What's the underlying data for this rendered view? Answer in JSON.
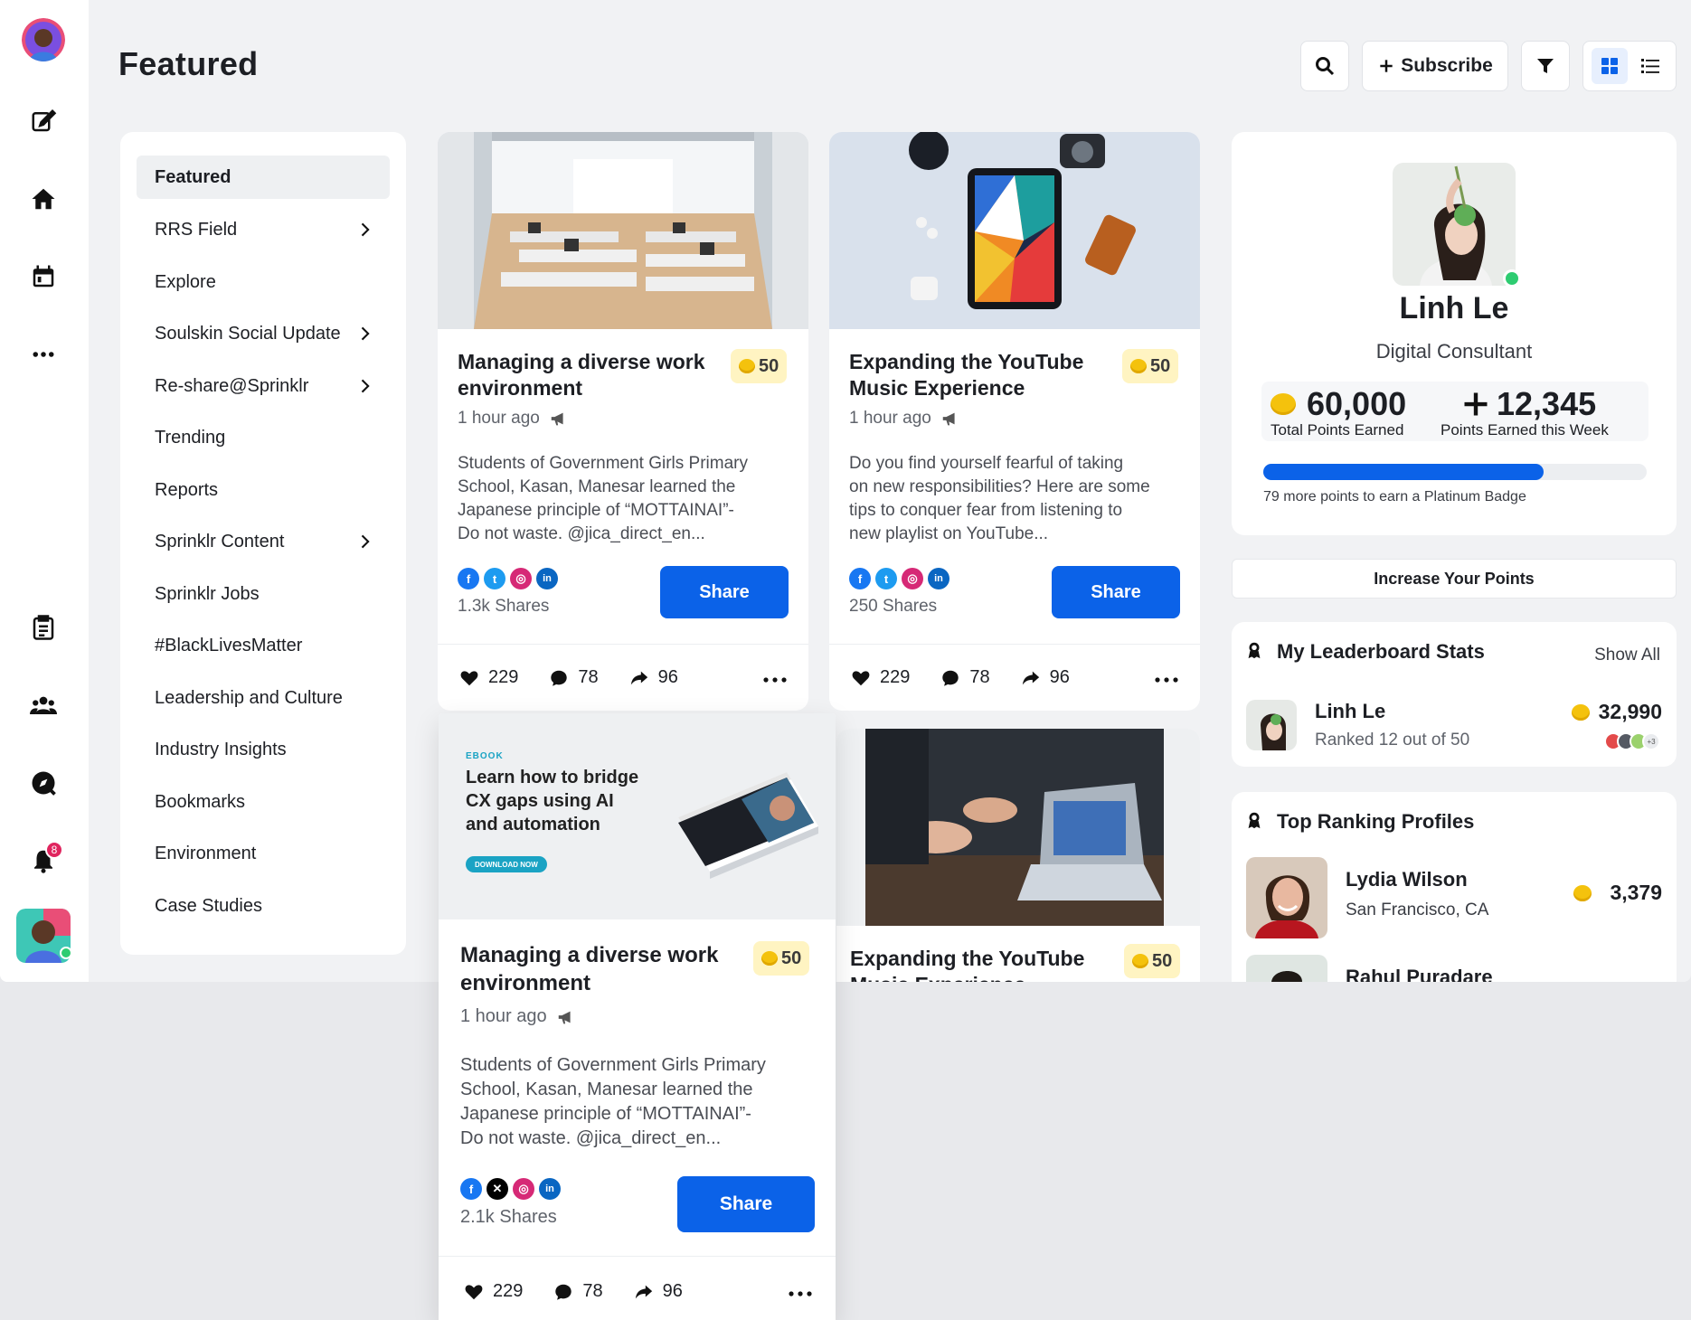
{
  "header": {
    "title": "Featured",
    "subscribe_label": "Subscribe"
  },
  "rail": {
    "notification_count": "8"
  },
  "nav": {
    "items": [
      {
        "label": "Featured"
      },
      {
        "label": "RRS Field"
      },
      {
        "label": "Explore"
      },
      {
        "label": "Soulskin Social Update"
      },
      {
        "label": "Re-share@Sprinklr"
      },
      {
        "label": "Trending"
      },
      {
        "label": "Reports"
      },
      {
        "label": "Sprinklr Content"
      },
      {
        "label": "Sprinklr Jobs"
      },
      {
        "label": "#BlackLivesMatter"
      },
      {
        "label": "Leadership and Culture"
      },
      {
        "label": "Industry Insights"
      },
      {
        "label": "Bookmarks"
      },
      {
        "label": "Environment"
      },
      {
        "label": "Case Studies"
      }
    ]
  },
  "posts": [
    {
      "title_line1": "Managing a diverse work",
      "title_line2": "environment",
      "points": "50",
      "time": "1 hour ago",
      "body_lines": [
        "Students of Government Girls Primary",
        "School, Kasan, Manesar learned the",
        "Japanese principle of “MOTTAINAI”-",
        "Do not waste. @jica_direct_en..."
      ],
      "shares": "1.3k Shares",
      "share_label": "Share",
      "likes": "229",
      "comments": "78",
      "reshares": "96"
    },
    {
      "title_line1": "Expanding the YouTube",
      "title_line2": "Music Experience",
      "points": "50",
      "time": "1 hour ago",
      "body_lines": [
        "Do you find yourself fearful of taking",
        "on new responsibilities? Here are some",
        "tips to conquer fear from listening to",
        "new playlist on YouTube..."
      ],
      "shares": "250 Shares",
      "share_label": "Share",
      "likes": "229",
      "comments": "78",
      "reshares": "96"
    },
    {
      "ebook_tag": "EBOOK",
      "ebook_line1": "Learn how to bridge",
      "ebook_line2": "CX gaps using AI",
      "ebook_line3": "and automation",
      "ebook_cta": "DOWNLOAD NOW",
      "title_line1": "Managing a diverse work",
      "title_line2": "environment",
      "points": "50",
      "time": "1 hour ago",
      "body_lines": [
        "Students of Government Girls Primary",
        "School, Kasan, Manesar learned the",
        "Japanese principle of “MOTTAINAI”-",
        "Do not waste. @jica_direct_en..."
      ],
      "shares": "2.1k Shares",
      "share_label": "Share",
      "likes": "229",
      "comments": "78",
      "reshares": "96"
    },
    {
      "title_line1": "Expanding the YouTube",
      "title_line2": "Music Experience",
      "points": "50"
    }
  ],
  "profile": {
    "name": "Linh Le",
    "role": "Digital Consultant",
    "total_points": "60,000",
    "total_points_label": "Total Points Earned",
    "week_points": "12,345",
    "week_points_label": "Points Earned this Week",
    "progress_fraction": 0.73,
    "progress_text": "79 more points to earn a Platinum Badge"
  },
  "increase_points_label": "Increase Your Points",
  "leaderboard": {
    "title": "My Leaderboard Stats",
    "show_all": "Show All",
    "name": "Linh Le",
    "rank": "Ranked 12 out of 50",
    "points": "32,990",
    "extra_badges": "+3"
  },
  "top_ranking": {
    "title": "Top Ranking Profiles",
    "profiles": [
      {
        "name": "Lydia Wilson",
        "location": "San Francisco, CA",
        "points": "3,379"
      },
      {
        "name": "Rahul Puradare"
      }
    ]
  },
  "colors": {
    "accent": "#0b62e8",
    "coin": "#f4c20d",
    "online": "#2ecc71",
    "notification": "#e0245e"
  }
}
